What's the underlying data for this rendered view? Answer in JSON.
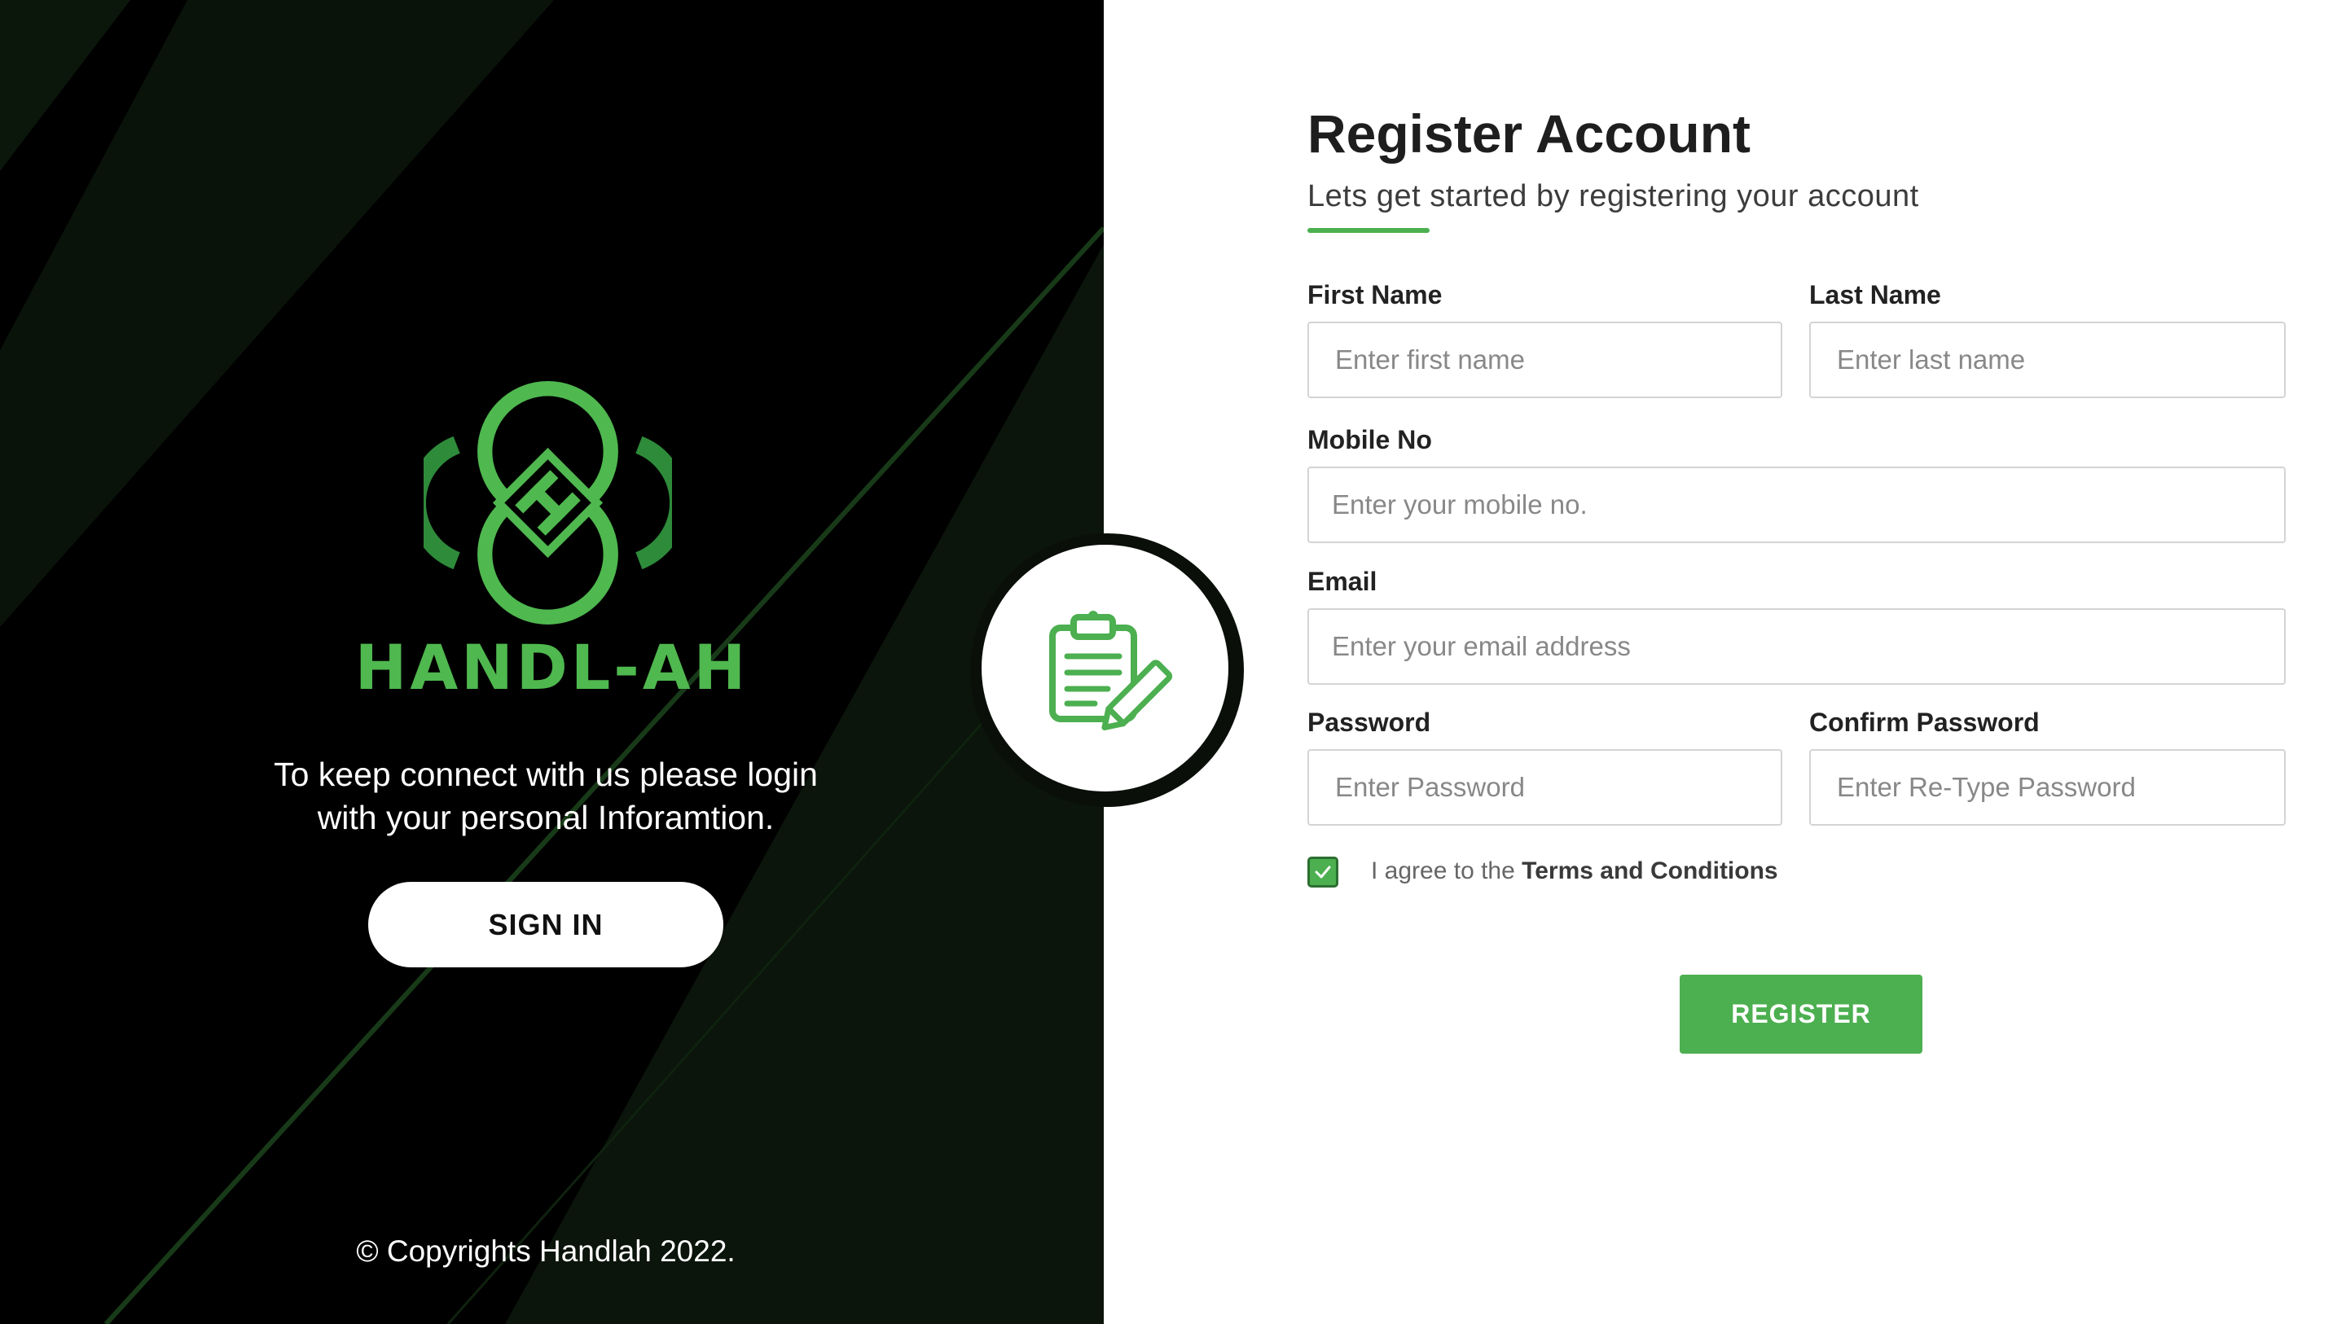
{
  "brand": {
    "name": "HANDL-AH",
    "logo_icon": "handlah-interlocking-rings-logo",
    "color": "#4fb84f"
  },
  "left_panel": {
    "tagline_line1": "To keep connect with us please login",
    "tagline_line2": "with your personal Inforamtion.",
    "signin_label": "SIGN IN",
    "copyright": "© Copyrights Handlah 2022.",
    "background": "#000000"
  },
  "badge": {
    "icon": "clipboard-edit-icon"
  },
  "form": {
    "title": "Register Account",
    "subtitle": "Lets get started by registering your account",
    "first_name": {
      "label": "First Name",
      "placeholder": "Enter first name",
      "value": ""
    },
    "last_name": {
      "label": "Last Name",
      "placeholder": "Enter last name",
      "value": ""
    },
    "mobile": {
      "label": "Mobile No",
      "placeholder": "Enter your mobile no.",
      "value": ""
    },
    "email": {
      "label": "Email",
      "placeholder": "Enter your email address",
      "value": ""
    },
    "password": {
      "label": "Password",
      "placeholder": "Enter Password",
      "value": ""
    },
    "confirm_password": {
      "label": "Confirm Password",
      "placeholder": "Enter Re-Type Password",
      "value": ""
    },
    "agree_prefix": "I agree to the",
    "agree_link": "Terms and Conditions",
    "agree_checked": true,
    "register_label": "REGISTER",
    "accent_color": "#4caf50"
  }
}
